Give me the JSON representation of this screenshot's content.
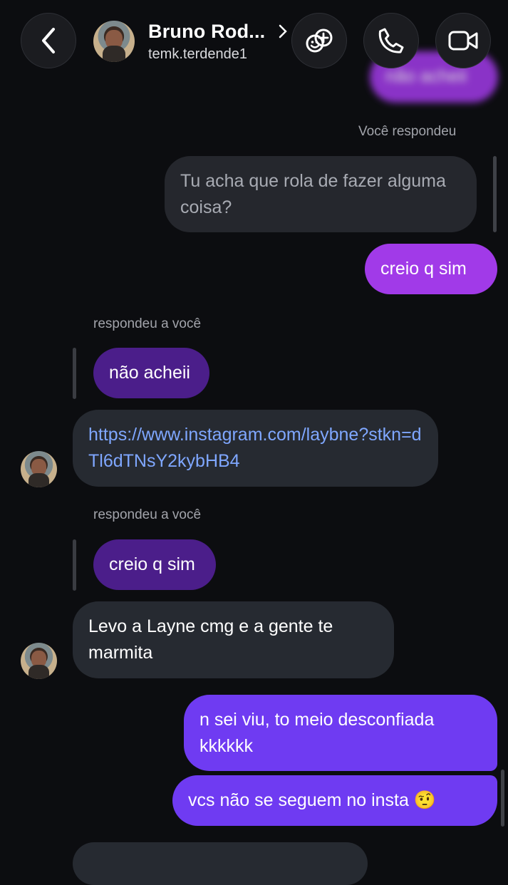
{
  "header": {
    "contact_name": "Bruno Rod...",
    "username": "temk.terdende1",
    "back_icon": "chevron-left-icon",
    "games_icon": "game-controller-icon",
    "call_icon": "phone-icon",
    "video_icon": "video-camera-icon"
  },
  "messages": {
    "partial_top": "não acheii",
    "you_replied_label": "Você respondeu",
    "quoted_question": "Tu acha que rola de fazer alguma coisa?",
    "reply_creio": "creio q sim",
    "replied_to_you_1": "respondeu a você",
    "quote_nao_acheii": "não acheii",
    "link_message": "https://www.instagram.com/laybne?stkn=dTl6dTNsY2kybHB4",
    "replied_to_you_2": "respondeu a você",
    "quote_creio": "creio q sim",
    "levo_message": "Levo a Layne cmg e a gente te marmita",
    "nsei_message": "n sei viu, to meio desconfiada kkkkkk",
    "vcs_message": "vcs não se seguem no insta 🤨"
  },
  "colors": {
    "background": "#0c0d10",
    "incoming_bubble": "#262a31",
    "outgoing_purple": "#a13ae8",
    "outgoing_violet": "#6f3bf2",
    "quoted_purple": "#4b1e8a",
    "link": "#7fa7ff"
  }
}
